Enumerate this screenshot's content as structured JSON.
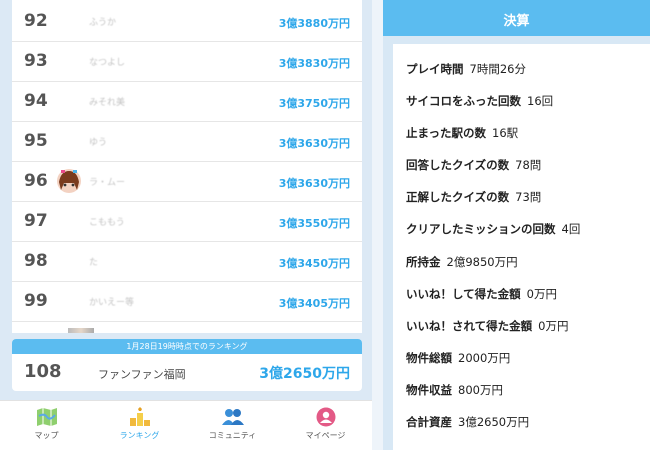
{
  "ranking": {
    "rows": [
      {
        "rank": "92",
        "name": "ふうか",
        "money": "3億3880万円"
      },
      {
        "rank": "93",
        "name": "なつよし",
        "money": "3億3830万円"
      },
      {
        "rank": "94",
        "name": "みそれ美",
        "money": "3億3750万円"
      },
      {
        "rank": "95",
        "name": "ゆう",
        "money": "3億3630万円"
      },
      {
        "rank": "96",
        "name": "ラ・ムー",
        "money": "3億3630万円"
      },
      {
        "rank": "97",
        "name": "こももう",
        "money": "3億3550万円"
      },
      {
        "rank": "98",
        "name": "た",
        "money": "3億3450万円"
      },
      {
        "rank": "99",
        "name": "かいえー等",
        "money": "3億3405万円"
      }
    ]
  },
  "my_rank": {
    "banner": "1月28日19時時点でのランキング",
    "rank": "108",
    "name": "ファンファン福岡",
    "money": "3億2650万円"
  },
  "nav": {
    "map": "マップ",
    "ranking": "ランキング",
    "community": "コミュニティ",
    "mypage": "マイページ",
    "active": "ranking"
  },
  "settlement": {
    "title": "決算",
    "stats": [
      {
        "label": "プレイ時間",
        "value": "7時間26分"
      },
      {
        "label": "サイコロをふった回数",
        "value": "16回"
      },
      {
        "label": "止まった駅の数",
        "value": "16駅"
      },
      {
        "label": "回答したクイズの数",
        "value": "78問"
      },
      {
        "label": "正解したクイズの数",
        "value": "73問"
      },
      {
        "label": "クリアしたミッションの回数",
        "value": "4回"
      },
      {
        "label": "所持金",
        "value": "2億9850万円"
      },
      {
        "label": "いいね！して得た金額",
        "value": "0万円"
      },
      {
        "label": "いいね！されて得た金額",
        "value": "0万円"
      },
      {
        "label": "物件総額",
        "value": "2000万円"
      },
      {
        "label": "物件収益",
        "value": "800万円"
      },
      {
        "label": "合計資産",
        "value": "3億2650万円"
      }
    ]
  },
  "colors": {
    "accent": "#5bbcf0",
    "money": "#2ea7ea",
    "background": "#dce9f5"
  }
}
